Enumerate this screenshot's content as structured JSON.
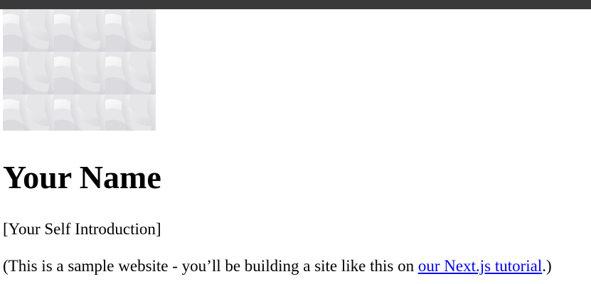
{
  "colors": {
    "top_bar": "#3a3a3a",
    "link": "#0000ee",
    "text": "#000000",
    "background": "#ffffff"
  },
  "hero": {
    "image_icon": "woven-pattern-image"
  },
  "title": "Your Name",
  "intro": "[Your Self Introduction]",
  "note": {
    "prefix": "(This is a sample website - you’ll be building a site like this on ",
    "link_text": "our Next.js tutorial",
    "suffix": ".)"
  }
}
